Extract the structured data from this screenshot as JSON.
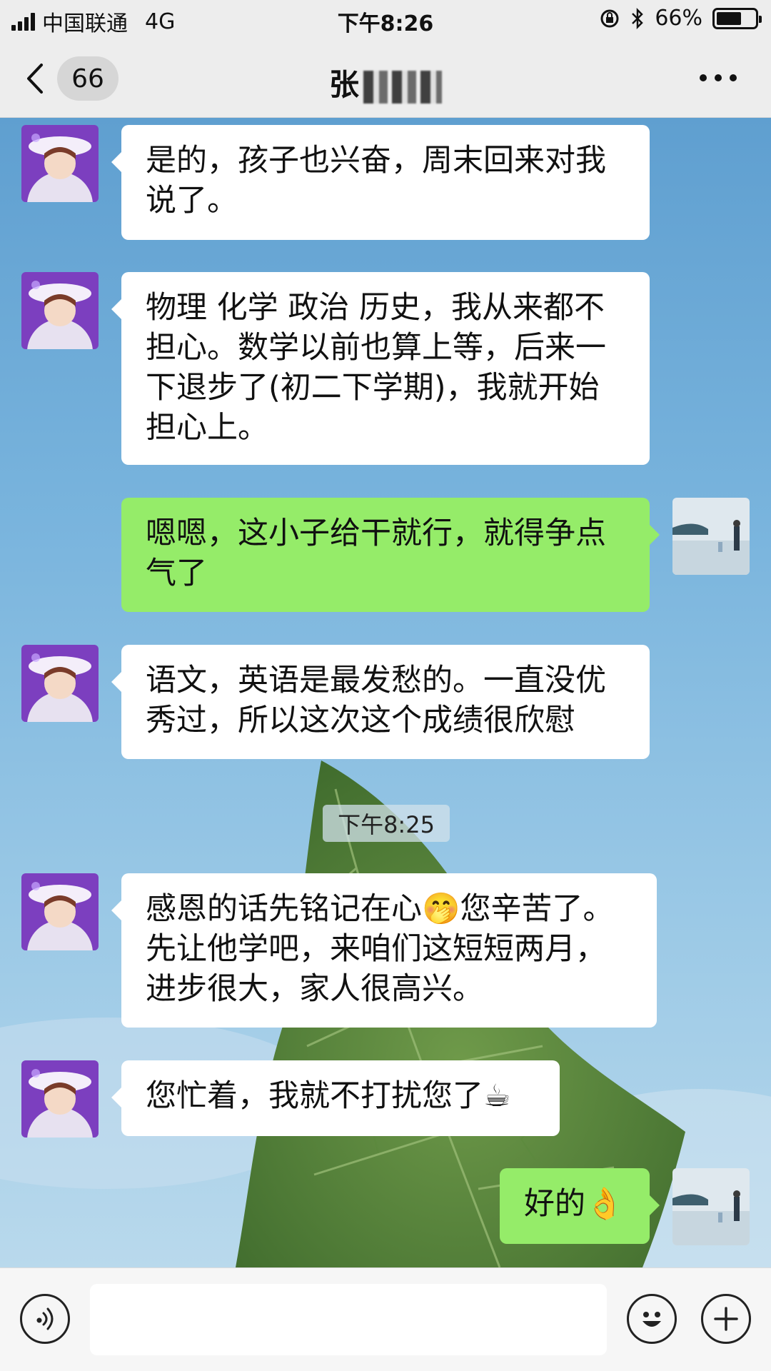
{
  "status_bar": {
    "carrier": "中国联通",
    "network": "4G",
    "time": "下午8:26",
    "battery": "66%",
    "battery_level": 0.66
  },
  "nav": {
    "unread_count": "66",
    "contact_name": "张"
  },
  "messages": [
    {
      "side": "in",
      "text": "是的，孩子也兴奋，周末回来对我说了。"
    },
    {
      "side": "in",
      "text": "物理 化学 政治 历史，我从来都不担心。数学以前也算上等，后来一下退步了(初二下学期)，我就开始担心上。"
    },
    {
      "side": "out",
      "text": "嗯嗯，这小子给干就行，就得争点气了"
    },
    {
      "side": "in",
      "text": "语文，英语是最发愁的。一直没优秀过，所以这次这个成绩很欣慰"
    },
    {
      "side": "in",
      "text": "感恩的话先铭记在心🤭您辛苦了。先让他学吧，来咱们这短短两月，进步很大，家人很高兴。"
    },
    {
      "side": "in",
      "text": "您忙着，我就不打扰您了☕"
    },
    {
      "side": "out",
      "text": "好的👌"
    }
  ],
  "timestamp": "下午8:25",
  "icons": {
    "back": "chevron-left-icon",
    "more": "more-dots-icon",
    "voice": "voice-icon",
    "emoji": "emoji-icon",
    "add": "plus-icon"
  },
  "colors": {
    "outgoing_bubble": "#95ec69",
    "incoming_bubble": "#ffffff",
    "bar_bg": "#ededed"
  }
}
